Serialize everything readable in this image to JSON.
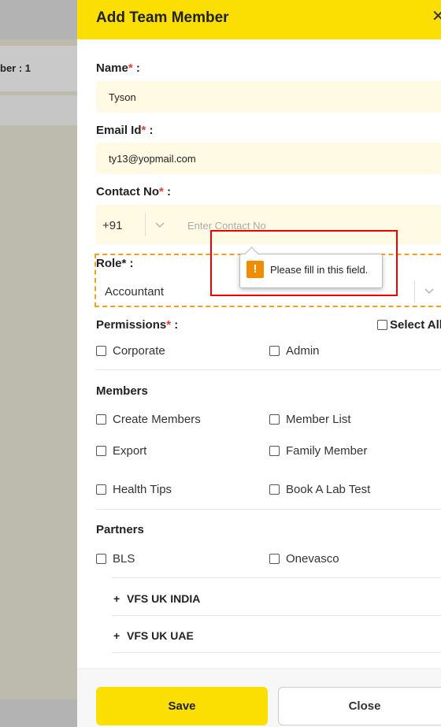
{
  "background": {
    "row_text": "ber : 1"
  },
  "drawer": {
    "title": "Add Team Member",
    "close_glyph": "✕"
  },
  "form": {
    "name": {
      "label": "Name",
      "required_mark": "*",
      "suffix": " :",
      "value": "Tyson"
    },
    "email": {
      "label": "Email Id",
      "required_mark": "*",
      "suffix": " :",
      "value": "ty13@yopmail.com"
    },
    "contact": {
      "label": "Contact No",
      "required_mark": "*",
      "suffix": " :",
      "country_code": "+91",
      "placeholder": "Enter Contact No"
    },
    "role": {
      "label": "Role",
      "required_mark": "*",
      "suffix": " :",
      "selected": "Accountant"
    }
  },
  "validation_tooltip": {
    "icon": "warning-icon",
    "message": "Please fill in this field."
  },
  "permissions": {
    "label": "Permissions",
    "required_mark": "*",
    "suffix": " :",
    "select_all": "Select All",
    "top": [
      "Corporate",
      "Admin"
    ],
    "members_title": "Members",
    "members": [
      "Create Members",
      "Member List",
      "Export",
      "Family Member",
      "Health Tips",
      "Book A Lab Test"
    ],
    "partners_title": "Partners",
    "partners": [
      "BLS",
      "Onevasco"
    ],
    "groups": [
      {
        "plus": "+",
        "label": "VFS UK INDIA"
      },
      {
        "plus": "+",
        "label": "VFS UK UAE"
      }
    ]
  },
  "footer": {
    "save_label": "Save",
    "close_label": "Close"
  },
  "colors": {
    "brand_yellow": "#fbde02",
    "field_bg": "#fefae4",
    "required": "#e53935",
    "focus_dash": "#f0a020",
    "highlight_box": "#ee0000"
  }
}
